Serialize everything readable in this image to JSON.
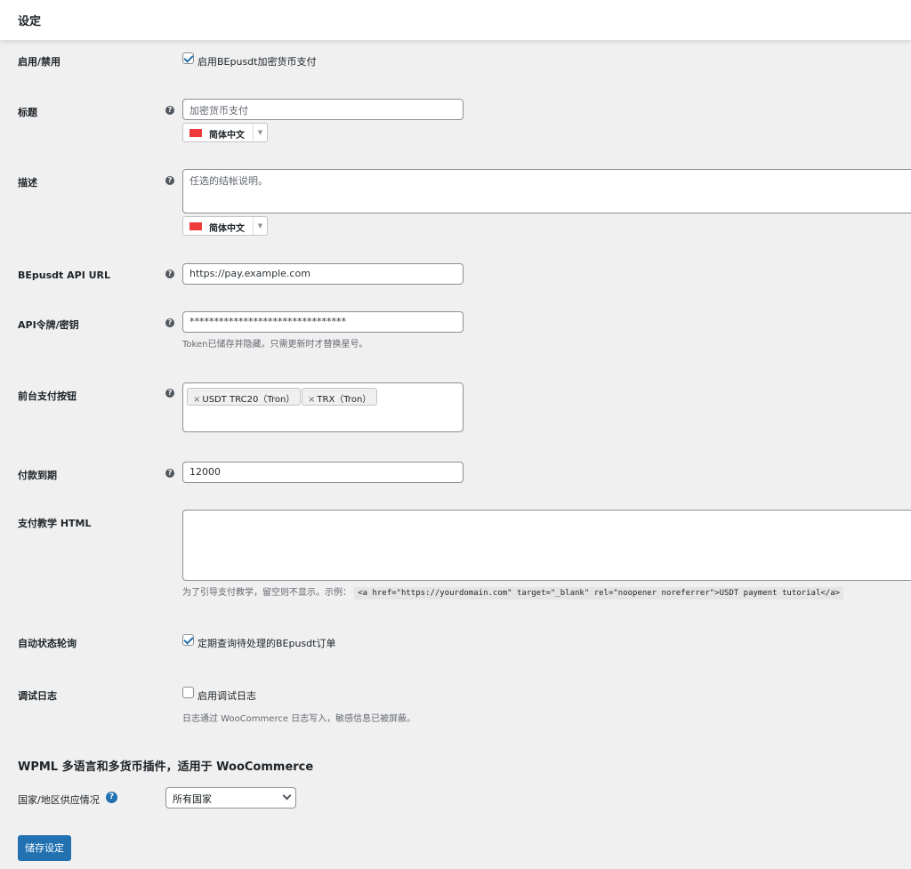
{
  "header": {
    "title": "设定"
  },
  "enable": {
    "label": "启用/禁用",
    "checkbox_label": "启用BEpusdt加密货币支付",
    "checked": true
  },
  "title_field": {
    "label": "标题",
    "value": "加密货币支付",
    "language": "简体中文"
  },
  "description": {
    "label": "描述",
    "placeholder": "任选的结帐说明。",
    "language": "简体中文"
  },
  "api_url": {
    "label": "BEpusdt API URL",
    "value": "https://pay.example.com"
  },
  "api_token": {
    "label": "API令牌/密钥",
    "value": "********************************",
    "help_text": "Token已储存并隐藏。只需更新时才替换星号。"
  },
  "payment_buttons": {
    "label": "前台支付按钮",
    "tags": [
      "USDT TRC20（Tron）",
      "TRX（Tron）"
    ],
    "remove_glyph": "×"
  },
  "expiry": {
    "label": "付款到期",
    "value": "12000"
  },
  "tutorial_html": {
    "label": "支付教学 HTML",
    "help_text": "为了引导支付教学，留空则不显示。示例：",
    "example_code": "<a href=\"https://yourdomain.com\" target=\"_blank\" rel=\"noopener noreferrer\">USDT payment tutorial</a>"
  },
  "auto_poll": {
    "label": "自动状态轮询",
    "checkbox_label": "定期查询待处理的BEpusdt订单",
    "checked": true
  },
  "debug_log": {
    "label": "调试日志",
    "checkbox_label": "启用调试日志",
    "checked": false,
    "help_text": "日志通过 WooCommerce 日志写入，敏感信息已被屏蔽。"
  },
  "wpml": {
    "section_title": "WPML 多语言和多货币插件，适用于 WooCommerce",
    "country_label": "国家/地区供应情况",
    "country_value": "所有国家"
  },
  "save_button": "储存设定",
  "help_glyph": "?",
  "colors": {
    "accent": "#2271b1",
    "flag": "#ee3b3b"
  }
}
